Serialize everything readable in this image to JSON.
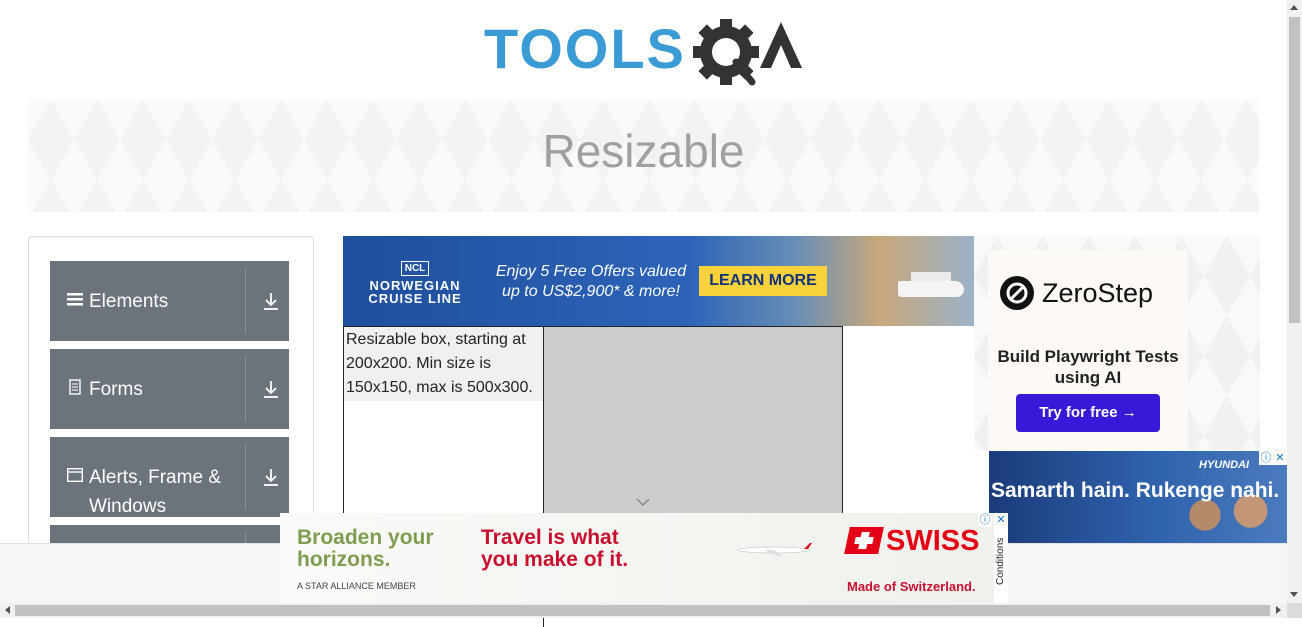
{
  "header": {
    "logo_text": "TOOLSQA"
  },
  "banner": {
    "title": "Resizable"
  },
  "sidebar": {
    "groups": [
      {
        "label": "Elements",
        "icon": "list-icon"
      },
      {
        "label": "Forms",
        "icon": "document-icon"
      },
      {
        "label": "Alerts, Frame & Windows",
        "icon": "window-icon"
      },
      {
        "label": "",
        "icon": ""
      }
    ]
  },
  "resizable": {
    "box_text": "Resizable box, starting at 200x200. Min size is 150x150, max is 500x300."
  },
  "ads": {
    "top": {
      "brand_badge": "NCL",
      "brand_name": "NORWEGIAN CRUISE LINE",
      "offer": "Enjoy 5 Free Offers valued up to US$2,900* & more!",
      "cta": "LEARN MORE"
    },
    "right": {
      "brand": "ZeroStep",
      "subtitle": "Build Playwright Tests using AI",
      "cta": "Try for free →"
    },
    "hyundai": {
      "brand": "HYUNDAI",
      "headline": "Samarth hain. Rukenge nahi."
    },
    "bottom": {
      "headline_1": "Broaden your horizons.",
      "headline_2": "Travel is what you make of it.",
      "alliance": "A STAR ALLIANCE MEMBER",
      "brand": "SWISS",
      "tagline": "Made of Switzerland.",
      "conditions": "Conditions"
    }
  },
  "colors": {
    "logo_blue": "#3a9bd5",
    "logo_dark": "#333333",
    "sidebar_group_bg": "#6c737b",
    "banner_title": "#a0a0a0",
    "zerostep_button": "#3719d8",
    "swiss_red": "#e30016"
  }
}
